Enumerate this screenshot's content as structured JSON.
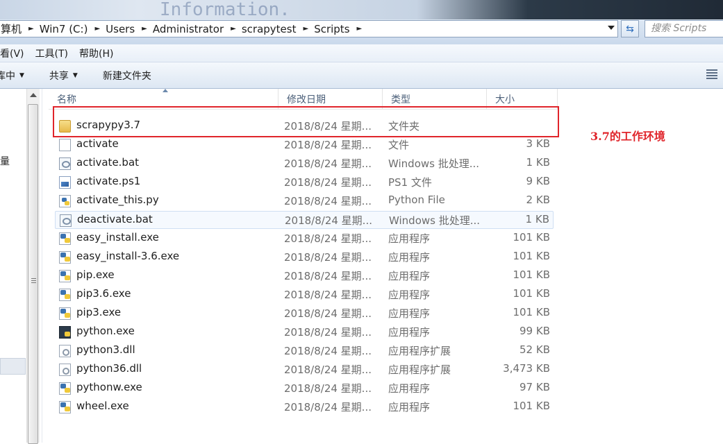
{
  "background_window": {
    "ghost_text": "Information."
  },
  "address_bar": {
    "crumbs": [
      "算机",
      "Win7 (C:)",
      "Users",
      "Administrator",
      "scrapytest",
      "Scripts"
    ],
    "search_placeholder": "搜索 Scripts"
  },
  "menu": {
    "items": [
      "看(V)",
      "工具(T)",
      "帮助(H)"
    ]
  },
  "toolbar": {
    "organize": "库中",
    "share": "共享",
    "new_folder": "新建文件夹"
  },
  "nav": {
    "partial_label": "量"
  },
  "columns": {
    "name": "名称",
    "date": "修改日期",
    "type": "类型",
    "size": "大小"
  },
  "files": [
    {
      "name": "scrapypy3.7",
      "date": "2018/8/24 星期...",
      "type": "文件夹",
      "size": "",
      "icon": "folder-icon"
    },
    {
      "name": "activate",
      "date": "2018/8/24 星期...",
      "type": "文件",
      "size": "3 KB",
      "icon": "file-icon"
    },
    {
      "name": "activate.bat",
      "date": "2018/8/24 星期...",
      "type": "Windows 批处理...",
      "size": "1 KB",
      "icon": "batch-file-icon"
    },
    {
      "name": "activate.ps1",
      "date": "2018/8/24 星期...",
      "type": "PS1 文件",
      "size": "9 KB",
      "icon": "powershell-file-icon"
    },
    {
      "name": "activate_this.py",
      "date": "2018/8/24 星期...",
      "type": "Python File",
      "size": "2 KB",
      "icon": "python-file-icon"
    },
    {
      "name": "deactivate.bat",
      "date": "2018/8/24 星期...",
      "type": "Windows 批处理...",
      "size": "1 KB",
      "icon": "batch-file-icon"
    },
    {
      "name": "easy_install.exe",
      "date": "2018/8/24 星期...",
      "type": "应用程序",
      "size": "101 KB",
      "icon": "python-exe-icon"
    },
    {
      "name": "easy_install-3.6.exe",
      "date": "2018/8/24 星期...",
      "type": "应用程序",
      "size": "101 KB",
      "icon": "python-exe-icon"
    },
    {
      "name": "pip.exe",
      "date": "2018/8/24 星期...",
      "type": "应用程序",
      "size": "101 KB",
      "icon": "python-exe-icon"
    },
    {
      "name": "pip3.6.exe",
      "date": "2018/8/24 星期...",
      "type": "应用程序",
      "size": "101 KB",
      "icon": "python-exe-icon"
    },
    {
      "name": "pip3.exe",
      "date": "2018/8/24 星期...",
      "type": "应用程序",
      "size": "101 KB",
      "icon": "python-exe-icon"
    },
    {
      "name": "python.exe",
      "date": "2018/8/24 星期...",
      "type": "应用程序",
      "size": "99 KB",
      "icon": "python-console-icon"
    },
    {
      "name": "python3.dll",
      "date": "2018/8/24 星期...",
      "type": "应用程序扩展",
      "size": "52 KB",
      "icon": "dll-file-icon"
    },
    {
      "name": "python36.dll",
      "date": "2018/8/24 星期...",
      "type": "应用程序扩展",
      "size": "3,473 KB",
      "icon": "dll-file-icon"
    },
    {
      "name": "pythonw.exe",
      "date": "2018/8/24 星期...",
      "type": "应用程序",
      "size": "97 KB",
      "icon": "python-exe-icon"
    },
    {
      "name": "wheel.exe",
      "date": "2018/8/24 星期...",
      "type": "应用程序",
      "size": "101 KB",
      "icon": "python-exe-icon"
    }
  ],
  "selected_index": 5,
  "annotation": {
    "text": "3.7的工作环境",
    "color": "#e0242a"
  }
}
